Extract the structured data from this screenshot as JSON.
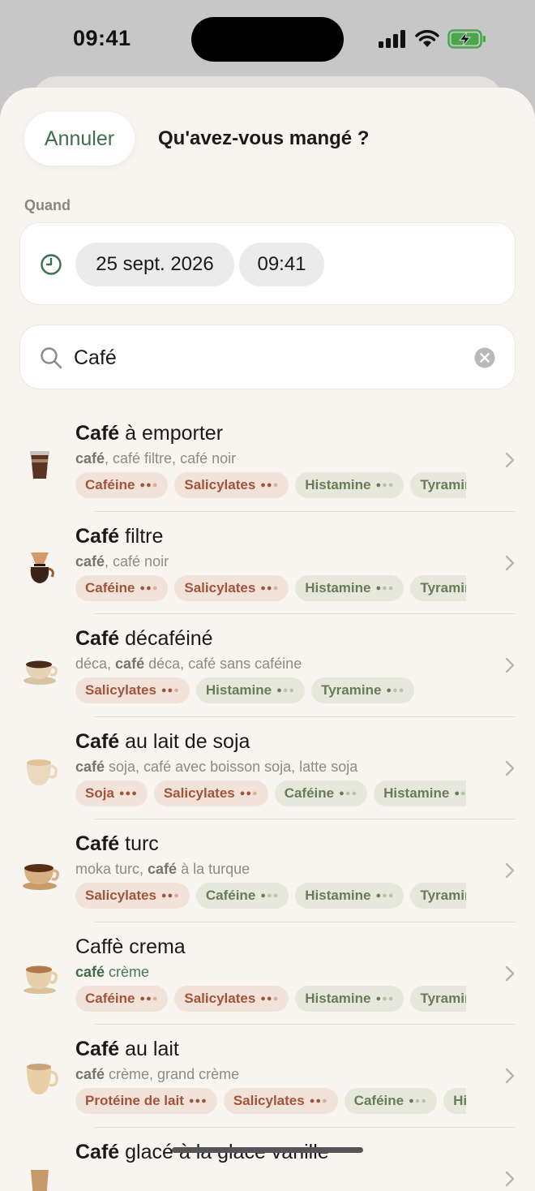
{
  "status_bar": {
    "time": "09:41"
  },
  "header": {
    "cancel_label": "Annuler",
    "title": "Qu'avez-vous mangé ?"
  },
  "when": {
    "label": "Quand",
    "date": "25 sept. 2026",
    "time": "09:41"
  },
  "search": {
    "value": "Café",
    "placeholder": ""
  },
  "results": [
    {
      "title_bold": "Café",
      "title_rest": " à emporter",
      "emoji": "takeaway-coffee",
      "subtitle": [
        {
          "b": "café"
        },
        {
          "t": ", café filtre, café noir"
        }
      ],
      "sub_green": false,
      "chips": [
        {
          "label": "Caféine",
          "color": "red",
          "level": 2
        },
        {
          "label": "Salicylates",
          "color": "red",
          "level": 2
        },
        {
          "label": "Histamine",
          "color": "green",
          "level": 1
        },
        {
          "label": "Tyramine",
          "color": "green",
          "level": 1
        }
      ]
    },
    {
      "title_bold": "Café",
      "title_rest": " filtre",
      "emoji": "filter-coffee",
      "subtitle": [
        {
          "b": "café"
        },
        {
          "t": ", café noir"
        }
      ],
      "sub_green": false,
      "chips": [
        {
          "label": "Caféine",
          "color": "red",
          "level": 2
        },
        {
          "label": "Salicylates",
          "color": "red",
          "level": 2
        },
        {
          "label": "Histamine",
          "color": "green",
          "level": 1
        },
        {
          "label": "Tyramine",
          "color": "green",
          "level": 1
        }
      ]
    },
    {
      "title_bold": "Café",
      "title_rest": " décaféiné",
      "emoji": "espresso-cup",
      "subtitle": [
        {
          "t": "déca, "
        },
        {
          "b": "café"
        },
        {
          "t": " déca, café sans caféine"
        }
      ],
      "sub_green": false,
      "chips": [
        {
          "label": "Salicylates",
          "color": "red",
          "level": 2
        },
        {
          "label": "Histamine",
          "color": "green",
          "level": 1
        },
        {
          "label": "Tyramine",
          "color": "green",
          "level": 1
        }
      ]
    },
    {
      "title_bold": "Café",
      "title_rest": " au lait de soja",
      "emoji": "milk-coffee-cup",
      "subtitle": [
        {
          "b": "café"
        },
        {
          "t": " soja, café avec boisson soja, latte soja"
        }
      ],
      "sub_green": false,
      "chips": [
        {
          "label": "Soja",
          "color": "red",
          "level": 3
        },
        {
          "label": "Salicylates",
          "color": "red",
          "level": 2
        },
        {
          "label": "Caféine",
          "color": "green",
          "level": 1
        },
        {
          "label": "Histamine",
          "color": "green",
          "level": 1
        }
      ]
    },
    {
      "title_bold": "Café",
      "title_rest": " turc",
      "emoji": "turkish-coffee-cup",
      "subtitle": [
        {
          "t": "moka turc, "
        },
        {
          "b": "café"
        },
        {
          "t": " à la turque"
        }
      ],
      "sub_green": false,
      "chips": [
        {
          "label": "Salicylates",
          "color": "red",
          "level": 2
        },
        {
          "label": "Caféine",
          "color": "green",
          "level": 1
        },
        {
          "label": "Histamine",
          "color": "green",
          "level": 1
        },
        {
          "label": "Tyramine",
          "color": "green",
          "level": 1
        }
      ]
    },
    {
      "title_bold": "",
      "title_rest": "Caffè crema",
      "emoji": "crema-cup",
      "subtitle": [
        {
          "b": "café"
        },
        {
          "t": " crème"
        }
      ],
      "sub_green": true,
      "chips": [
        {
          "label": "Caféine",
          "color": "red",
          "level": 2
        },
        {
          "label": "Salicylates",
          "color": "red",
          "level": 2
        },
        {
          "label": "Histamine",
          "color": "green",
          "level": 1
        },
        {
          "label": "Tyramine",
          "color": "green",
          "level": 1
        }
      ]
    },
    {
      "title_bold": "Café",
      "title_rest": " au lait",
      "emoji": "latte-cup",
      "subtitle": [
        {
          "b": "café"
        },
        {
          "t": " crème, grand crème"
        }
      ],
      "sub_green": false,
      "chips": [
        {
          "label": "Protéine de lait",
          "color": "red",
          "level": 3
        },
        {
          "label": "Salicylates",
          "color": "red",
          "level": 2
        },
        {
          "label": "Caféine",
          "color": "green",
          "level": 1
        },
        {
          "label": "Histamine",
          "color": "green",
          "level": 1
        }
      ]
    },
    {
      "title_bold": "Café",
      "title_rest": " glacé à la glace vanille",
      "emoji": "iced-coffee",
      "subtitle": [],
      "sub_green": false,
      "chips": []
    }
  ],
  "colors": {
    "accent": "#3d6e4f",
    "sheet": "#f8f5f1",
    "chip_red_bg": "#f2e3da",
    "chip_green_bg": "#e7e8dc"
  }
}
